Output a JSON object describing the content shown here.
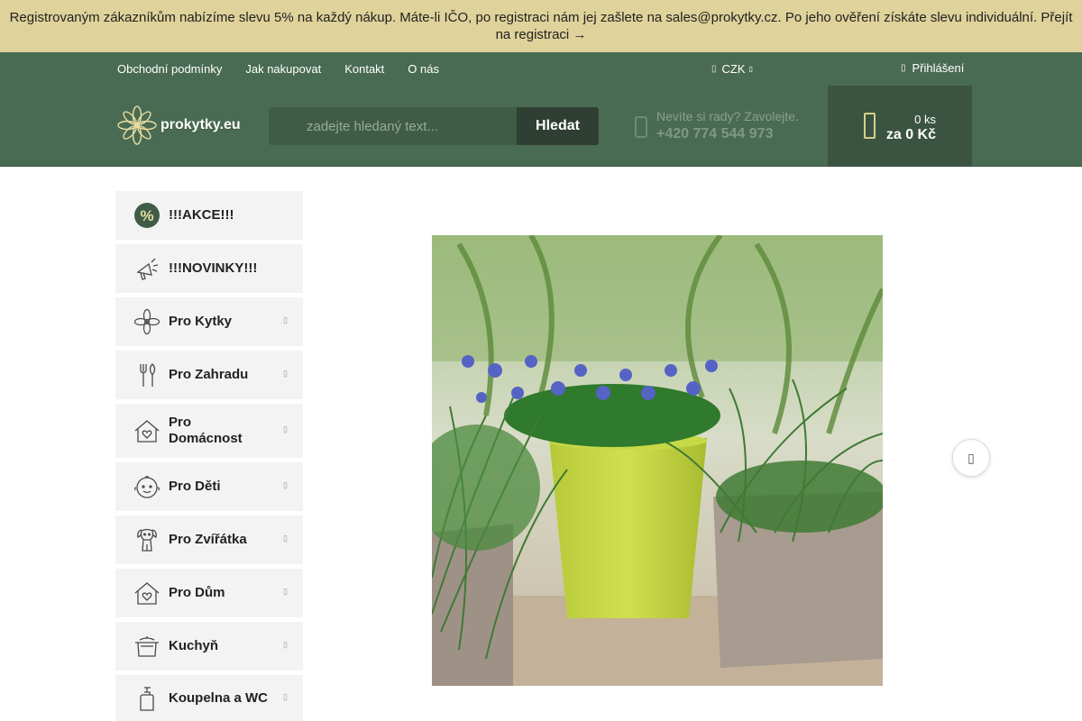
{
  "promo": {
    "text": "Registrovaným zákazníkům nabízíme slevu 5% na každý nákup. Máte-li IČO, po registraci nám jej zašlete na sales@prokytky.cz. Po jeho ověření získáte slevu individuální. Přejít na registraci →"
  },
  "topnav": {
    "links": [
      "Obchodní podmínky",
      "Jak nakupovat",
      "Kontakt",
      "O nás"
    ],
    "currency": "CZK",
    "login": "Přihlášení"
  },
  "header": {
    "logo_text": "prokytky.eu",
    "search_placeholder": "zadejte hledaný text...",
    "search_button": "Hledat",
    "help_text": "Nevíte si rady? Zavolejte.",
    "phone": "+420 774 544 973",
    "cart_count": "0 ks",
    "cart_total": "za 0 Kč"
  },
  "sidebar": {
    "items": [
      {
        "label": "!!!AKCE!!!",
        "icon": "percent-badge-icon"
      },
      {
        "label": "!!!NOVINKY!!!",
        "icon": "megaphone-icon"
      },
      {
        "label": "Pro Kytky",
        "icon": "flower-icon"
      },
      {
        "label": "Pro Zahradu",
        "icon": "garden-tools-icon"
      },
      {
        "label": "Pro Domácnost",
        "icon": "house-heart-icon"
      },
      {
        "label": "Pro Děti",
        "icon": "baby-face-icon"
      },
      {
        "label": "Pro Zvířátka",
        "icon": "dog-icon"
      },
      {
        "label": "Pro Dům",
        "icon": "house-heart-icon"
      },
      {
        "label": "Kuchyň",
        "icon": "cooking-pot-icon"
      },
      {
        "label": "Koupelna a WC",
        "icon": "soap-dispenser-icon"
      }
    ]
  },
  "colors": {
    "promo_bg": "#dfd29a",
    "header_green": "#4a6b53",
    "cart_bg": "#3a5441",
    "search_button_bg": "#2f3f33",
    "sidebar_item_bg": "#f3f3f3"
  }
}
